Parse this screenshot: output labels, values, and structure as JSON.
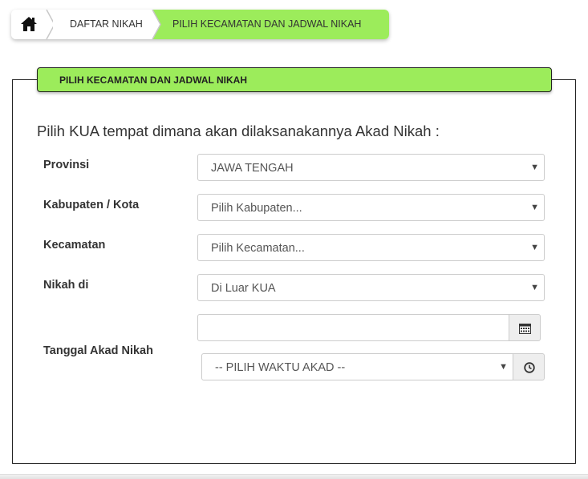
{
  "breadcrumb": {
    "home_icon": "home-icon",
    "items": [
      {
        "label": "DAFTAR NIKAH"
      },
      {
        "label": "PILIH KECAMATAN DAN JADWAL NIKAH"
      }
    ],
    "active_color": "#9cec5b"
  },
  "panel": {
    "title": "PILIH KECAMATAN DAN JADWAL NIKAH",
    "intro": "Pilih KUA tempat dimana akan dilaksanakannya Akad Nikah :"
  },
  "form": {
    "provinsi": {
      "label": "Provinsi",
      "value": "JAWA TENGAH"
    },
    "kabupaten": {
      "label": "Kabupaten / Kota",
      "value": "Pilih Kabupaten..."
    },
    "kecamatan": {
      "label": "Kecamatan",
      "value": "Pilih Kecamatan..."
    },
    "nikah_di": {
      "label": "Nikah di",
      "value": "Di Luar KUA"
    },
    "tanggal": {
      "label": "Tanggal Akad Nikah",
      "date_value": "",
      "calendar_icon": "calendar-icon",
      "time_value": "-- PILIH WAKTU AKAD --",
      "clock_icon": "clock-icon"
    }
  }
}
